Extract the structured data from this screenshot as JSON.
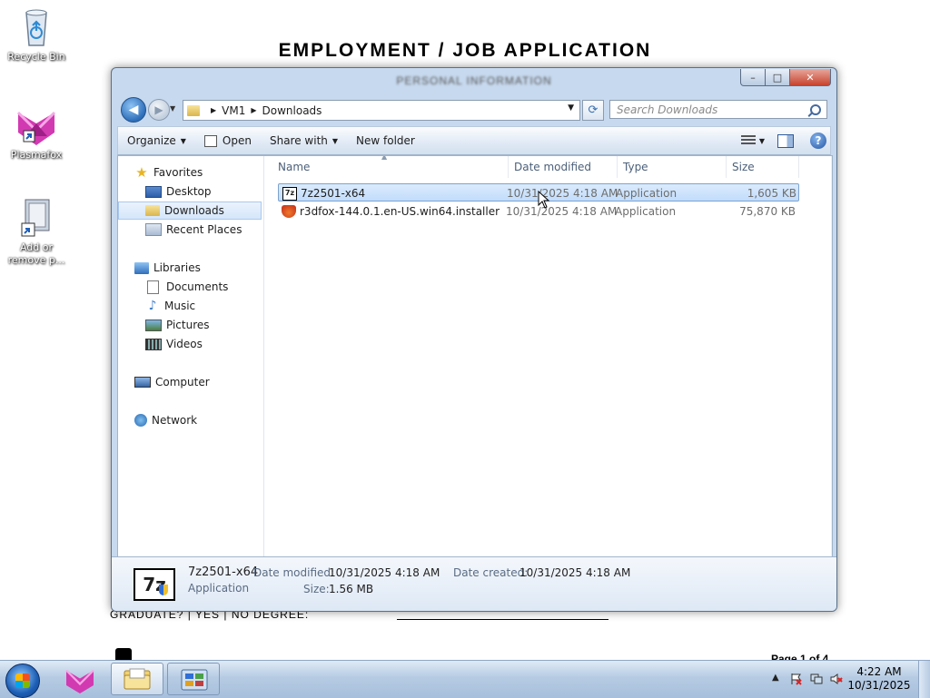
{
  "desktop": {
    "icons": [
      {
        "label": "Recycle Bin"
      },
      {
        "label": "Plasmafox"
      },
      {
        "label": "Add or remove p..."
      }
    ]
  },
  "background_doc": {
    "title": "EMPLOYMENT / JOB APPLICATION",
    "graduate_line": "GRADUATE? | YES | NO DEGREE:",
    "page_label": "Page 1 of 4"
  },
  "window": {
    "title": "PERSONAL INFORMATION",
    "controls": {
      "minimize": "–",
      "maximize": "□",
      "close": "✕"
    },
    "breadcrumb": [
      "VM1",
      "Downloads"
    ],
    "search_placeholder": "Search Downloads",
    "toolbar": {
      "organize": "Organize",
      "open": "Open",
      "share_with": "Share with",
      "new_folder": "New folder"
    },
    "nav": {
      "favorites": "Favorites",
      "desktop": "Desktop",
      "downloads": "Downloads",
      "recent_places": "Recent Places",
      "libraries": "Libraries",
      "documents": "Documents",
      "music": "Music",
      "pictures": "Pictures",
      "videos": "Videos",
      "computer": "Computer",
      "network": "Network"
    },
    "columns": {
      "name": "Name",
      "date_modified": "Date modified",
      "type": "Type",
      "size": "Size"
    },
    "files": [
      {
        "name": "7z2501-x64",
        "date": "10/31/2025 4:18 AM",
        "type": "Application",
        "size": "1,605 KB"
      },
      {
        "name": "r3dfox-144.0.1.en-US.win64.installer",
        "date": "10/31/2025 4:18 AM",
        "type": "Application",
        "size": "75,870 KB"
      }
    ],
    "details": {
      "icon_text": "7z",
      "name": "7z2501-x64",
      "type": "Application",
      "date_modified_label": "Date modified:",
      "date_modified": "10/31/2025 4:18 AM",
      "date_created_label": "Date created:",
      "date_created": "10/31/2025 4:18 AM",
      "size_label": "Size:",
      "size": "1.56 MB"
    }
  },
  "taskbar": {
    "time": "4:22 AM",
    "date": "10/31/2025"
  }
}
